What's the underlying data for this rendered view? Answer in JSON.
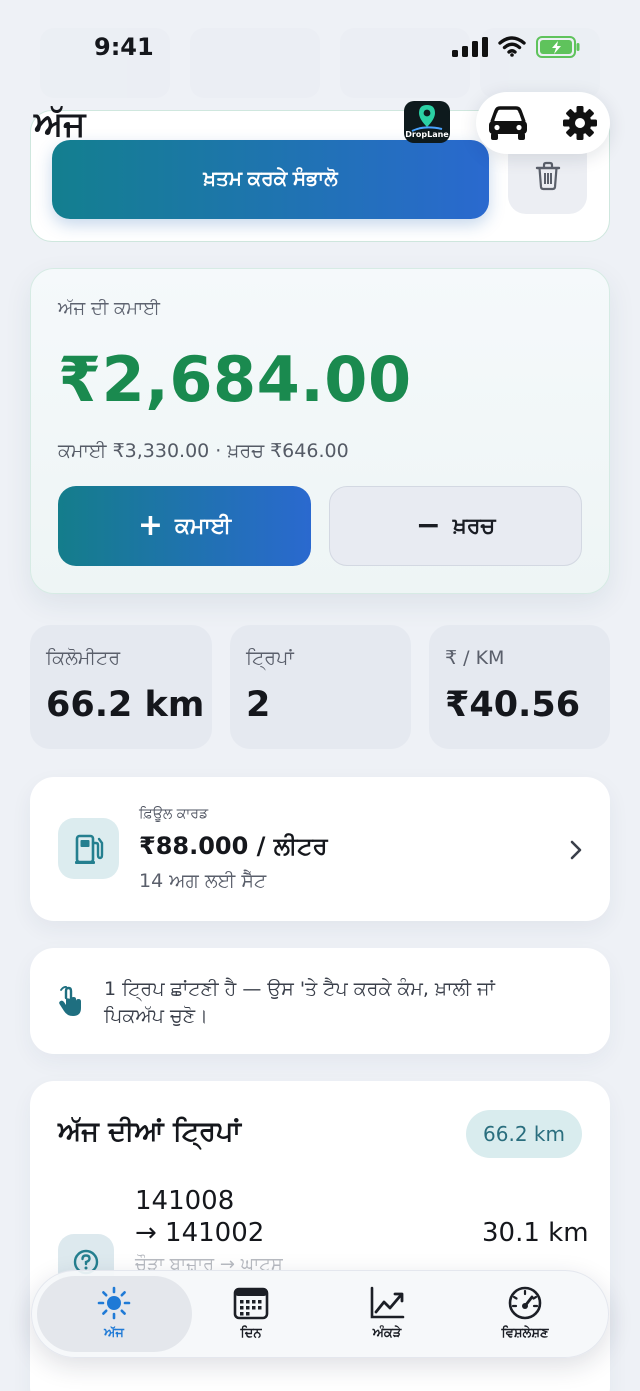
{
  "status_bar": {
    "time": "9:41"
  },
  "header": {
    "title": "ਅੱਜ",
    "logo_text": "DropLane"
  },
  "session": {
    "finish_label": "ਖ਼ਤਮ ਕਰਕੇ ਸੰਭਾਲੋ"
  },
  "earnings": {
    "label": "ਅੱਜ ਦੀ ਕਮਾਈ",
    "total": "₹2,684.00",
    "breakdown": "ਕਮਾਈ ₹3,330.00 · ਖ਼ਰਚ ₹646.00",
    "earn_button": "ਕਮਾਈ",
    "earn_glyph": "+",
    "expense_button": "ਖ਼ਰਚ",
    "expense_glyph": "−"
  },
  "stats": [
    {
      "label": "ਕਿਲੋਮੀਟਰ",
      "value": "66.2 km"
    },
    {
      "label": "ਟ੍ਰਿਪਾਂ",
      "value": "2"
    },
    {
      "label": "₹ / KM",
      "value": "₹40.56"
    }
  ],
  "fuel": {
    "label": "ਫ਼ਿਊਲ ਕਾਰਡ",
    "price": "₹88.000 / ਲੀਟਰ",
    "sub": "14 ਅਗ ਲਈ ਸੈੱਟ"
  },
  "hint": {
    "text": "1 ਟ੍ਰਿਪ ਛਾਂਟਣੀ ਹੈ — ਉਸ 'ਤੇ ਟੈਪ ਕਰਕੇ ਕੰਮ, ਖ਼ਾਲੀ ਜਾਂ ਪਿਕਅੱਪ ਚੁਣੋ।"
  },
  "trips": {
    "title": "ਅੱਜ ਦੀਆਂ ਟ੍ਰਿਪਾਂ",
    "total_badge": "66.2 km",
    "items": [
      {
        "from": "141008",
        "to": "→ 141002",
        "distance": "30.1 km",
        "sub": "ਚੌੜਾ ਬਾਜ਼ਾਰ → ਘਾਟਸ"
      }
    ]
  },
  "nav": {
    "items": [
      {
        "label": "ਅੱਜ",
        "icon": "sun-icon"
      },
      {
        "label": "ਦਿਨ",
        "icon": "calendar-icon"
      },
      {
        "label": "ਅੰਕੜੇ",
        "icon": "chart-icon"
      },
      {
        "label": "ਵਿਸ਼ਲੇਸ਼ਣ",
        "icon": "speedometer-icon"
      }
    ]
  },
  "colors": {
    "accent_green": "#1a8a4f",
    "gradient_start": "#137f8f",
    "gradient_end": "#2a69cf",
    "active_nav": "#1f7ad6"
  }
}
